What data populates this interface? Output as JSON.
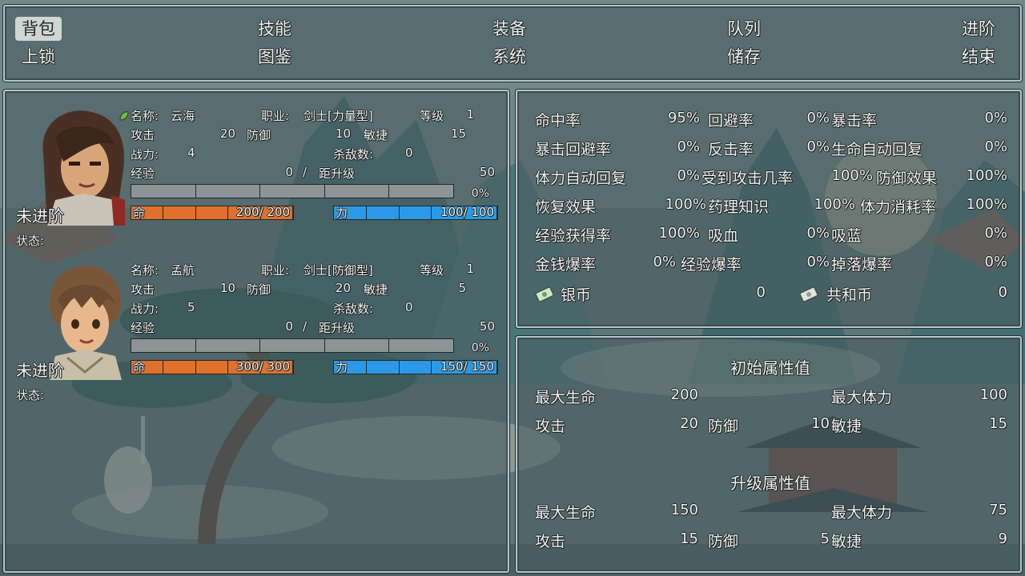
{
  "menu": {
    "row1": [
      {
        "label": "背包",
        "selected": true
      },
      {
        "label": "技能",
        "selected": false
      },
      {
        "label": "装备",
        "selected": false
      },
      {
        "label": "队列",
        "selected": false
      },
      {
        "label": "进阶",
        "selected": false
      }
    ],
    "row2": [
      {
        "label": "上锁"
      },
      {
        "label": "图鉴"
      },
      {
        "label": "系统"
      },
      {
        "label": "储存"
      },
      {
        "label": "结束"
      }
    ]
  },
  "party": [
    {
      "name_label": "名称:",
      "name": "云海",
      "job_label": "职业:",
      "job": "剑士[力量型]",
      "level_label": "等级",
      "level": "1",
      "atk_label": "攻击",
      "atk": "20",
      "def_label": "防御",
      "def": "10",
      "agi_label": "敏捷",
      "agi": "15",
      "power_label": "战力:",
      "power": "4",
      "kills_label": "杀敌数:",
      "kills": "0",
      "exp_label": "经验",
      "exp": "0",
      "exp_sep": "/",
      "next_label": "距升级",
      "next": "50",
      "exp_pct": "0%",
      "exp_fraction": 0,
      "hp_label": "命",
      "hp": "200/ 200",
      "hp_fraction": 1,
      "mp_label": "力",
      "mp": "100/ 100",
      "mp_fraction": 1,
      "adv": "未进阶",
      "status_label": "状态:",
      "portrait_icon": "swordsman-longhair-portrait",
      "has_leaf_icon": true
    },
    {
      "name_label": "名称:",
      "name": "孟航",
      "job_label": "职业:",
      "job": "剑士[防御型]",
      "level_label": "等级",
      "level": "1",
      "atk_label": "攻击",
      "atk": "10",
      "def_label": "防御",
      "def": "20",
      "agi_label": "敏捷",
      "agi": "5",
      "power_label": "战力:",
      "power": "5",
      "kills_label": "杀敌数:",
      "kills": "0",
      "exp_label": "经验",
      "exp": "0",
      "exp_sep": "/",
      "next_label": "距升级",
      "next": "50",
      "exp_pct": "0%",
      "exp_fraction": 0,
      "hp_label": "命",
      "hp": "300/ 300",
      "hp_fraction": 1,
      "mp_label": "力",
      "mp": "150/ 150",
      "mp_fraction": 1,
      "adv": "未进阶",
      "status_label": "状态:",
      "portrait_icon": "swordsman-shorthair-portrait",
      "has_leaf_icon": false
    }
  ],
  "stats": {
    "rows": [
      [
        {
          "label": "命中率",
          "value": "95%"
        },
        {
          "label": "回避率",
          "value": "0%"
        },
        {
          "label": "暴击率",
          "value": "0%"
        }
      ],
      [
        {
          "label": "暴击回避率",
          "value": "0%"
        },
        {
          "label": "反击率",
          "value": "0%"
        },
        {
          "label": "生命自动回复",
          "value": "0%"
        }
      ],
      [
        {
          "label": "体力自动回复",
          "value": "0%"
        },
        {
          "label": "受到攻击几率",
          "value": "100%"
        },
        {
          "label": "防御效果",
          "value": "100%"
        }
      ],
      [
        {
          "label": "恢复效果",
          "value": "100%"
        },
        {
          "label": "药理知识",
          "value": "100%"
        },
        {
          "label": "体力消耗率",
          "value": "100%"
        }
      ],
      [
        {
          "label": "经验获得率",
          "value": "100%"
        },
        {
          "label": "吸血",
          "value": "0%"
        },
        {
          "label": "吸蓝",
          "value": "0%"
        }
      ],
      [
        {
          "label": "金钱爆率",
          "value": "0%"
        },
        {
          "label": "经验爆率",
          "value": "0%"
        },
        {
          "label": "掉落爆率",
          "value": "0%"
        }
      ]
    ],
    "silver_label": "银币",
    "silver": "0",
    "silver_icon": "silver-coin-icon",
    "republic_label": "共和币",
    "republic": "0",
    "republic_icon": "republic-coin-icon"
  },
  "base_attrs": {
    "title": "初始属性值",
    "max_hp_label": "最大生命",
    "max_hp": "200",
    "max_sp_label": "最大体力",
    "max_sp": "100",
    "atk_label": "攻击",
    "atk": "20",
    "def_label": "防御",
    "def": "10",
    "agi_label": "敏捷",
    "agi": "15"
  },
  "growth_attrs": {
    "title": "升级属性值",
    "max_hp_label": "最大生命",
    "max_hp": "150",
    "max_sp_label": "最大体力",
    "max_sp": "75",
    "atk_label": "攻击",
    "atk": "15",
    "def_label": "防御",
    "def": "5",
    "agi_label": "敏捷",
    "agi": "9"
  },
  "colors": {
    "hp": "#e0702c",
    "mp": "#2b9ae6",
    "exp": "#8e9496",
    "panel_border": "#b9c3c6",
    "menu_highlight": "#e6e8e4"
  }
}
